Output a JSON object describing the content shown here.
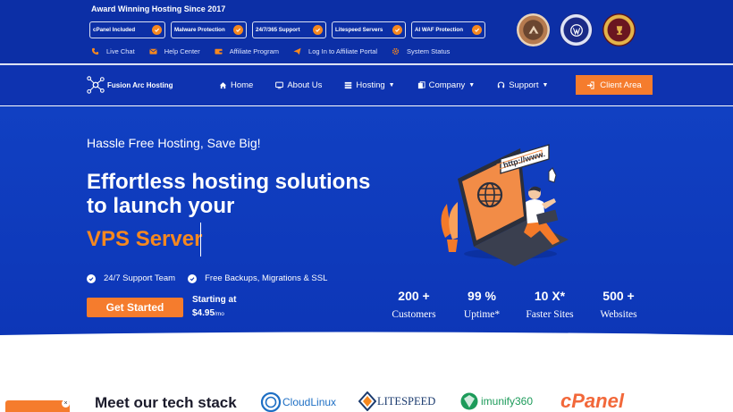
{
  "topbar": {
    "award": "Award Winning Hosting Since 2017",
    "badges": [
      "cPanel Included",
      "Malware Protection",
      "24/7/365 Support",
      "Litespeed Servers",
      "AI WAF Protection"
    ],
    "links": [
      "Live Chat",
      "Help Center",
      "Affiliate Program",
      "Log In to Affiliate Portal",
      "System Status"
    ]
  },
  "nav": {
    "brand": "Fusion Arc Hosting",
    "items": [
      "Home",
      "About Us",
      "Hosting",
      "Company",
      "Support"
    ],
    "client_area": "Client Area"
  },
  "hero": {
    "tagline": "Hassle Free Hosting, Save Big!",
    "headline": "Effortless hosting solutions to launch your",
    "highlight": "VPS Server",
    "features": [
      "24/7 Support Team",
      "Free Backups, Migrations & SSL"
    ],
    "cta": "Get Started",
    "starting_label": "Starting at",
    "price": "$4.95",
    "price_unit": "/mo",
    "illustration_url_text": "http://www.",
    "stats": [
      {
        "value": "200 +",
        "label": "Customers"
      },
      {
        "value": "99 %",
        "label": "Uptime*"
      },
      {
        "value": "10 X*",
        "label": "Faster Sites"
      },
      {
        "value": "500 +",
        "label": "Websites"
      }
    ]
  },
  "tech": {
    "title": "Meet our tech stack",
    "logos": [
      "CloudLinux",
      "LITESPEED",
      "imunify360",
      "cPanel"
    ]
  },
  "colors": {
    "primary": "#0d37b8",
    "accent": "#f57c2d"
  }
}
